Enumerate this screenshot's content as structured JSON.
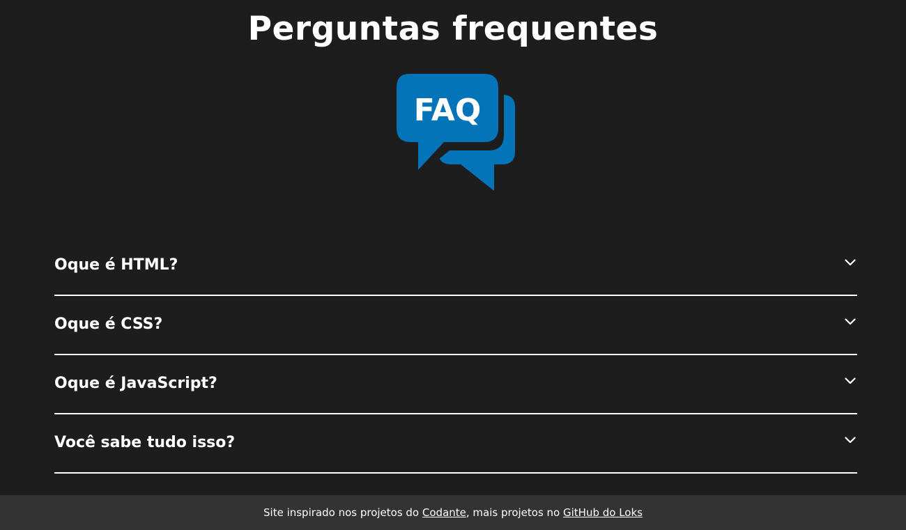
{
  "header": {
    "title": "Perguntas frequentes",
    "logo_text": "FAQ",
    "logo_color": "#0474b9"
  },
  "faq": {
    "items": [
      {
        "question": "Oque é HTML?",
        "icon": "chevron-down-icon"
      },
      {
        "question": "Oque é CSS?",
        "icon": "chevron-down-icon"
      },
      {
        "question": "Oque é JavaScript?",
        "icon": "chevron-down-icon"
      },
      {
        "question": "Você sabe tudo isso?",
        "icon": "chevron-down-icon"
      }
    ]
  },
  "footer": {
    "text_before": "Site inspirado nos projetos do ",
    "link1_label": "Codante",
    "text_middle": ", mais projetos no ",
    "link2_label": "GitHub do Loks",
    "background": "#333333"
  },
  "colors": {
    "background": "#1d1d1d",
    "text": "#ffffff"
  }
}
